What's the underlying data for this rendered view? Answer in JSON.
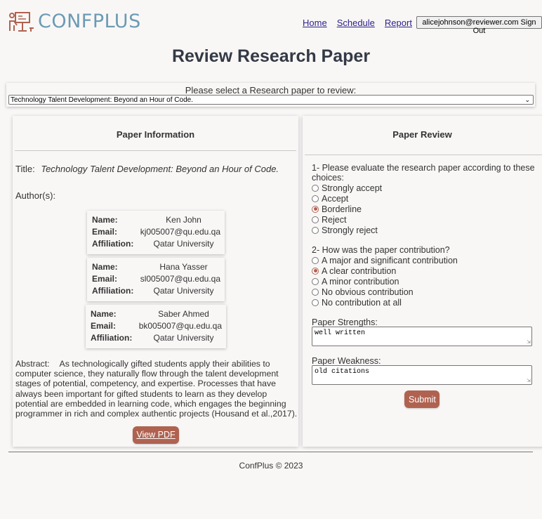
{
  "header": {
    "logo_text": "CONFPLUS",
    "nav": {
      "home": "Home",
      "schedule": "Schedule",
      "report": "Report"
    },
    "signout_label": "alicejohnson@reviewer.com Sign Out"
  },
  "page_title": "Review Research Paper",
  "paper_select": {
    "label": "Please select a Research paper to review:",
    "selected": "Technology Talent Development: Beyond an Hour of Code."
  },
  "paper_info": {
    "heading": "Paper Information",
    "title_label": "Title:",
    "title": "Technology Talent Development: Beyond an Hour of Code.",
    "authors_label": "Author(s):",
    "field_labels": {
      "name": "Name:",
      "email": "Email:",
      "affiliation": "Affiliation:"
    },
    "authors": [
      {
        "name": "Ken John",
        "email": "kj005007@qu.edu.qa",
        "affiliation": "Qatar University"
      },
      {
        "name": "Hana Yasser",
        "email": "sl005007@qu.edu.qa",
        "affiliation": "Qatar University"
      },
      {
        "name": "Saber Ahmed",
        "email": "bk005007@qu.edu.qa",
        "affiliation": "Qatar University"
      }
    ],
    "abstract_label": "Abstract:",
    "abstract": "As technologically gifted students apply their abilities to computer science, they naturally flow through the talent development stages of potential, competency, and expertise. Processes that have always been important for gifted students to learn as they develop potential are embedded in learning code, which engages the beginning programmer in rich and complex authentic projects (Housand et al.,2017).",
    "view_pdf_label": "View PDF"
  },
  "review": {
    "heading": "Paper Review",
    "q1": "1- Please evaluate the research paper according to these choices:",
    "q1_options": [
      "Strongly accept",
      "Accept",
      "Borderline",
      "Reject",
      "Strongly reject"
    ],
    "q1_selected": "Borderline",
    "q2": "2- How was the paper contribution?",
    "q2_options": [
      "A major and significant contribution",
      "A clear contribution",
      "A minor contribution",
      "No obvious contribution",
      "No contribution at all"
    ],
    "q2_selected": "A clear contribution",
    "strengths_label": "Paper Strengths:",
    "strengths_value": "well written",
    "weakness_label": "Paper Weakness:",
    "weakness_value": "old citations",
    "submit_label": "Submit"
  },
  "footer": "ConfPlus © 2023",
  "colors": {
    "accent": "#b06250",
    "logo": "#6b9bb5",
    "background": "#f9f7f6"
  }
}
